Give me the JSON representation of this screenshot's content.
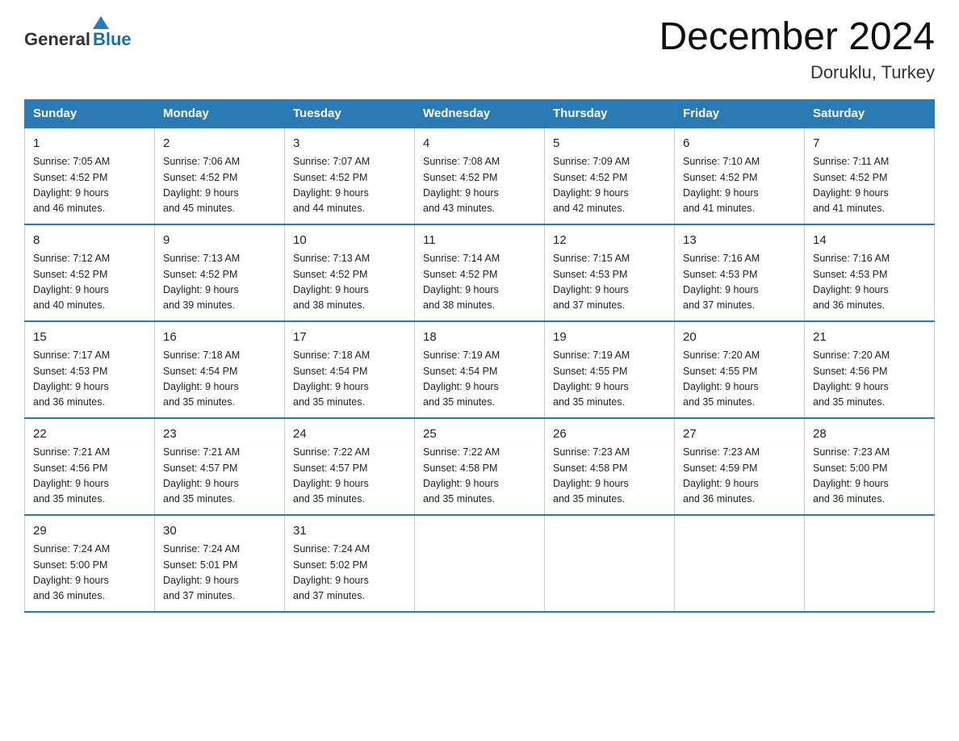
{
  "header": {
    "logo_general": "General",
    "logo_blue": "Blue",
    "month_year": "December 2024",
    "location": "Doruklu, Turkey"
  },
  "days_of_week": [
    "Sunday",
    "Monday",
    "Tuesday",
    "Wednesday",
    "Thursday",
    "Friday",
    "Saturday"
  ],
  "weeks": [
    [
      {
        "day": "1",
        "sunrise": "7:05 AM",
        "sunset": "4:52 PM",
        "daylight": "9 hours and 46 minutes."
      },
      {
        "day": "2",
        "sunrise": "7:06 AM",
        "sunset": "4:52 PM",
        "daylight": "9 hours and 45 minutes."
      },
      {
        "day": "3",
        "sunrise": "7:07 AM",
        "sunset": "4:52 PM",
        "daylight": "9 hours and 44 minutes."
      },
      {
        "day": "4",
        "sunrise": "7:08 AM",
        "sunset": "4:52 PM",
        "daylight": "9 hours and 43 minutes."
      },
      {
        "day": "5",
        "sunrise": "7:09 AM",
        "sunset": "4:52 PM",
        "daylight": "9 hours and 42 minutes."
      },
      {
        "day": "6",
        "sunrise": "7:10 AM",
        "sunset": "4:52 PM",
        "daylight": "9 hours and 41 minutes."
      },
      {
        "day": "7",
        "sunrise": "7:11 AM",
        "sunset": "4:52 PM",
        "daylight": "9 hours and 41 minutes."
      }
    ],
    [
      {
        "day": "8",
        "sunrise": "7:12 AM",
        "sunset": "4:52 PM",
        "daylight": "9 hours and 40 minutes."
      },
      {
        "day": "9",
        "sunrise": "7:13 AM",
        "sunset": "4:52 PM",
        "daylight": "9 hours and 39 minutes."
      },
      {
        "day": "10",
        "sunrise": "7:13 AM",
        "sunset": "4:52 PM",
        "daylight": "9 hours and 38 minutes."
      },
      {
        "day": "11",
        "sunrise": "7:14 AM",
        "sunset": "4:52 PM",
        "daylight": "9 hours and 38 minutes."
      },
      {
        "day": "12",
        "sunrise": "7:15 AM",
        "sunset": "4:53 PM",
        "daylight": "9 hours and 37 minutes."
      },
      {
        "day": "13",
        "sunrise": "7:16 AM",
        "sunset": "4:53 PM",
        "daylight": "9 hours and 37 minutes."
      },
      {
        "day": "14",
        "sunrise": "7:16 AM",
        "sunset": "4:53 PM",
        "daylight": "9 hours and 36 minutes."
      }
    ],
    [
      {
        "day": "15",
        "sunrise": "7:17 AM",
        "sunset": "4:53 PM",
        "daylight": "9 hours and 36 minutes."
      },
      {
        "day": "16",
        "sunrise": "7:18 AM",
        "sunset": "4:54 PM",
        "daylight": "9 hours and 35 minutes."
      },
      {
        "day": "17",
        "sunrise": "7:18 AM",
        "sunset": "4:54 PM",
        "daylight": "9 hours and 35 minutes."
      },
      {
        "day": "18",
        "sunrise": "7:19 AM",
        "sunset": "4:54 PM",
        "daylight": "9 hours and 35 minutes."
      },
      {
        "day": "19",
        "sunrise": "7:19 AM",
        "sunset": "4:55 PM",
        "daylight": "9 hours and 35 minutes."
      },
      {
        "day": "20",
        "sunrise": "7:20 AM",
        "sunset": "4:55 PM",
        "daylight": "9 hours and 35 minutes."
      },
      {
        "day": "21",
        "sunrise": "7:20 AM",
        "sunset": "4:56 PM",
        "daylight": "9 hours and 35 minutes."
      }
    ],
    [
      {
        "day": "22",
        "sunrise": "7:21 AM",
        "sunset": "4:56 PM",
        "daylight": "9 hours and 35 minutes."
      },
      {
        "day": "23",
        "sunrise": "7:21 AM",
        "sunset": "4:57 PM",
        "daylight": "9 hours and 35 minutes."
      },
      {
        "day": "24",
        "sunrise": "7:22 AM",
        "sunset": "4:57 PM",
        "daylight": "9 hours and 35 minutes."
      },
      {
        "day": "25",
        "sunrise": "7:22 AM",
        "sunset": "4:58 PM",
        "daylight": "9 hours and 35 minutes."
      },
      {
        "day": "26",
        "sunrise": "7:23 AM",
        "sunset": "4:58 PM",
        "daylight": "9 hours and 35 minutes."
      },
      {
        "day": "27",
        "sunrise": "7:23 AM",
        "sunset": "4:59 PM",
        "daylight": "9 hours and 36 minutes."
      },
      {
        "day": "28",
        "sunrise": "7:23 AM",
        "sunset": "5:00 PM",
        "daylight": "9 hours and 36 minutes."
      }
    ],
    [
      {
        "day": "29",
        "sunrise": "7:24 AM",
        "sunset": "5:00 PM",
        "daylight": "9 hours and 36 minutes."
      },
      {
        "day": "30",
        "sunrise": "7:24 AM",
        "sunset": "5:01 PM",
        "daylight": "9 hours and 37 minutes."
      },
      {
        "day": "31",
        "sunrise": "7:24 AM",
        "sunset": "5:02 PM",
        "daylight": "9 hours and 37 minutes."
      },
      null,
      null,
      null,
      null
    ]
  ],
  "labels": {
    "sunrise": "Sunrise:",
    "sunset": "Sunset:",
    "daylight": "Daylight:"
  }
}
